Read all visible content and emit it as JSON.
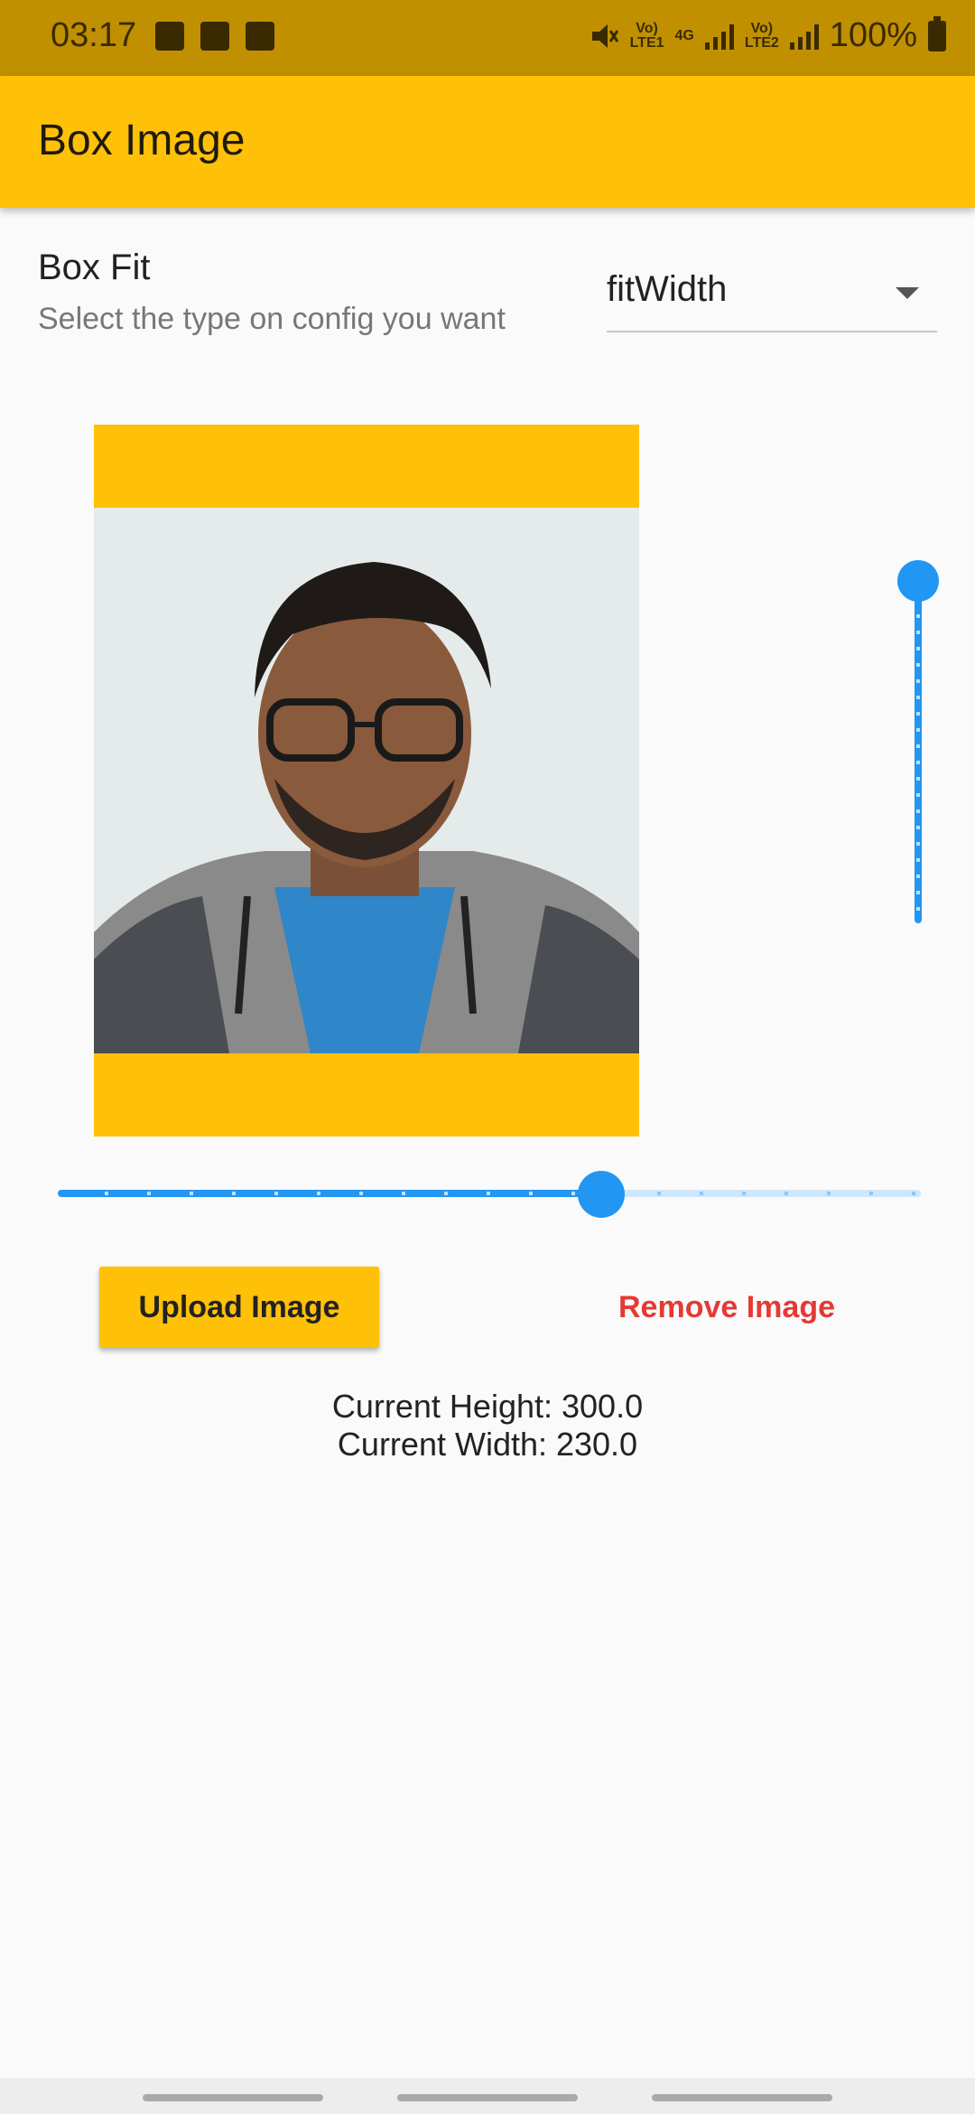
{
  "status_bar": {
    "time": "03:17",
    "battery_text": "100%",
    "sim1_tag": "Vo)\nLTE1",
    "net_tag": "4G",
    "sim2_tag": "Vo)\nLTE2",
    "icons": [
      "image-icon",
      "clock-icon",
      "wifi-calling-icon",
      "mute-icon",
      "signal-icon",
      "battery-icon"
    ]
  },
  "app_bar": {
    "title": "Box Image",
    "color": "#ffc107"
  },
  "box_fit": {
    "title": "Box Fit",
    "subtitle": "Select the type on config you want",
    "selected": "fitWidth"
  },
  "sliders": {
    "height_fraction": 1.0,
    "width_fraction": 0.63,
    "accent": "#2196f3"
  },
  "buttons": {
    "upload_label": "Upload Image",
    "remove_label": "Remove Image"
  },
  "info": {
    "height_text": "Current Height: 300.0",
    "width_text": "Current Width: 230.0"
  }
}
